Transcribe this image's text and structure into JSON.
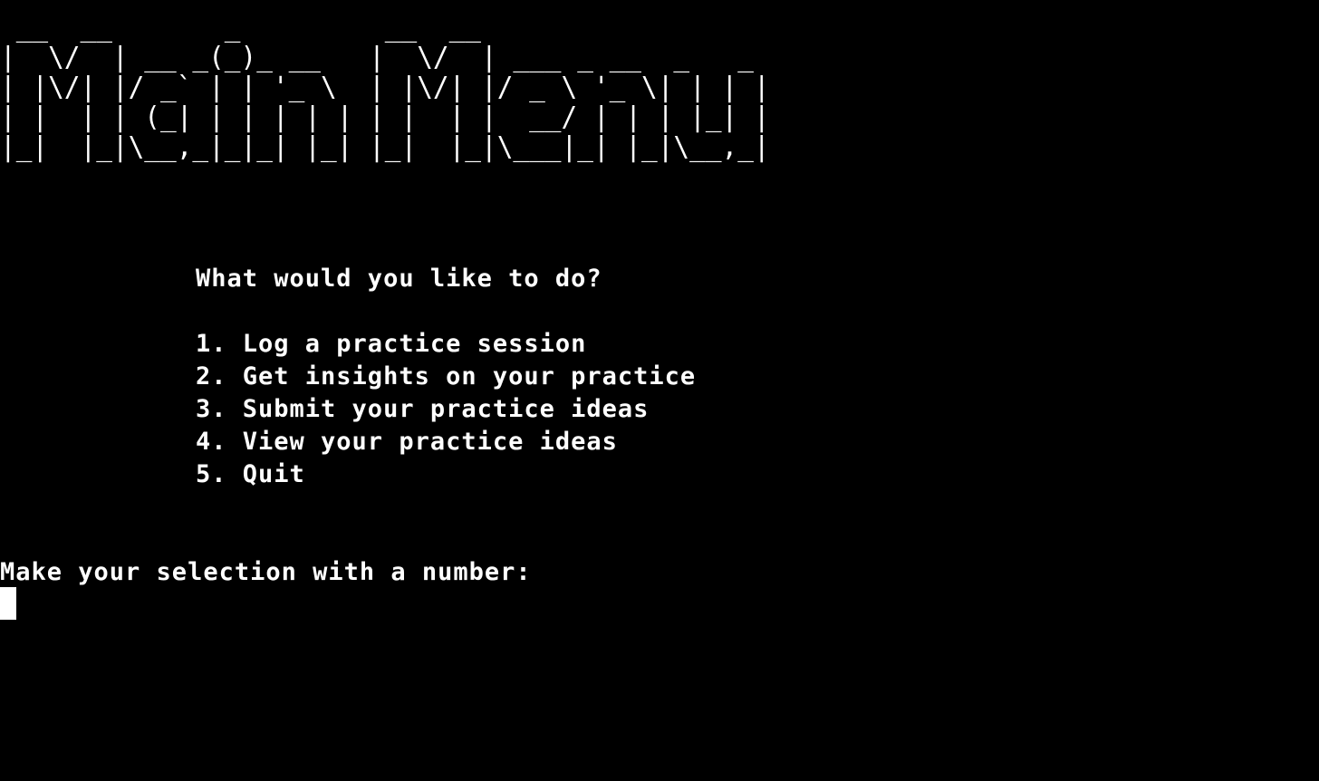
{
  "banner": {
    "lines": [
      " __  __       _         __  __",
      "|  \\/  | __ _(_)_ __   |  \\/  | ___ _ __  _   _",
      "| |\\/| |/ _` | | '_ \\  | |\\/| |/ _ \\ '_ \\| | | |",
      "| |  | | (_| | | | | | | |  | |  __/ | | | |_| |",
      "|_|  |_|\\__,_|_|_| |_| |_|  |_|\\___|_| |_|\\__,_|"
    ]
  },
  "menu": {
    "question": "What would you like to do?",
    "options": [
      "1. Log a practice session",
      "2. Get insights on your practice",
      "3. Submit your practice ideas",
      "4. View your practice ideas",
      "5. Quit"
    ]
  },
  "prompt": {
    "text": "Make your selection with a number:"
  },
  "colors": {
    "background": "#000000",
    "foreground": "#ffffff"
  }
}
